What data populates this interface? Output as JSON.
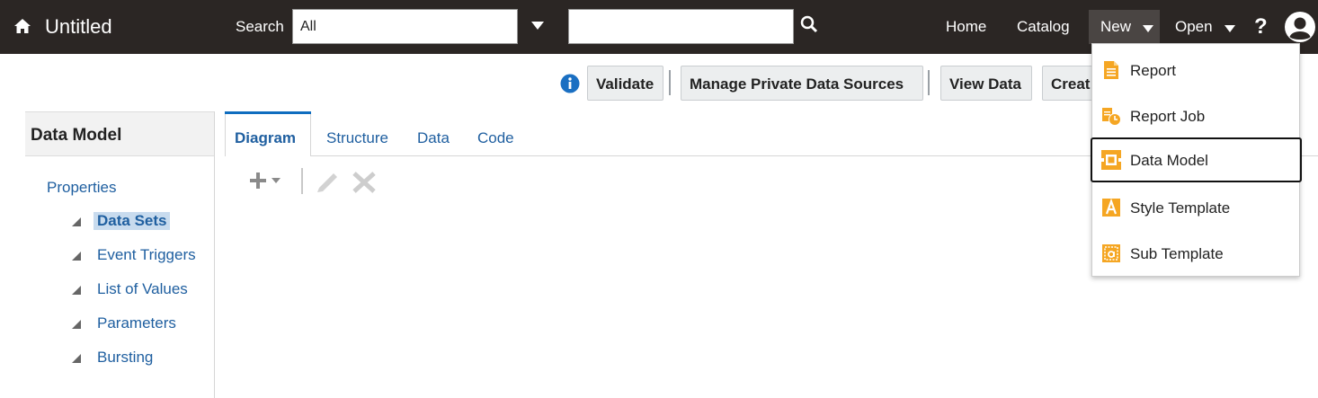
{
  "header": {
    "title": "Untitled",
    "search_label": "Search",
    "search_scope": "All",
    "search_query": "",
    "nav": {
      "home": "Home",
      "catalog": "Catalog",
      "new": "New",
      "open": "Open",
      "help": "?"
    }
  },
  "toolbar": {
    "validate": "Validate",
    "manage_sources": "Manage Private Data Sources",
    "view_data": "View Data",
    "create": "Creat"
  },
  "sidebar": {
    "title": "Data Model",
    "properties": "Properties",
    "items": [
      {
        "label": "Data Sets",
        "selected": true
      },
      {
        "label": "Event Triggers",
        "selected": false
      },
      {
        "label": "List of Values",
        "selected": false
      },
      {
        "label": "Parameters",
        "selected": false
      },
      {
        "label": "Bursting",
        "selected": false
      }
    ]
  },
  "tabs": [
    {
      "label": "Diagram",
      "active": true
    },
    {
      "label": "Structure",
      "active": false
    },
    {
      "label": "Data",
      "active": false
    },
    {
      "label": "Code",
      "active": false
    }
  ],
  "new_menu": {
    "items": [
      {
        "label": "Report",
        "icon": "report-icon"
      },
      {
        "label": "Report Job",
        "icon": "report-job-icon"
      },
      {
        "label": "Data Model",
        "icon": "data-model-icon"
      },
      {
        "label": "Style Template",
        "icon": "style-template-icon"
      },
      {
        "label": "Sub Template",
        "icon": "sub-template-icon"
      }
    ],
    "focused": "Data Model"
  },
  "colors": {
    "header_bg": "#2b2624",
    "link": "#1f5fa0",
    "accent": "#0f6dbf",
    "icon_orange": "#f5a623"
  }
}
